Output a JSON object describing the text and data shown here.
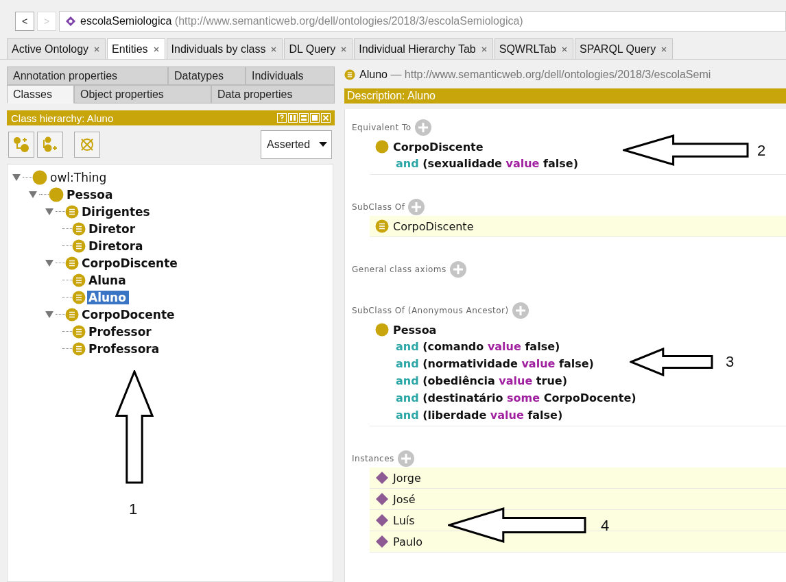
{
  "nav": {
    "back": "<",
    "forward": ">",
    "forward_disabled": true,
    "ontology": {
      "name": "escolaSemiologica",
      "iri": "(http://www.semanticweb.org/dell/ontologies/2018/3/escolaSemiologica)"
    }
  },
  "tabs": [
    {
      "label": "Active Ontology",
      "selected": false
    },
    {
      "label": "Entities",
      "selected": true
    },
    {
      "label": "Individuals by class",
      "selected": false
    },
    {
      "label": "DL Query",
      "selected": false
    },
    {
      "label": "Individual Hierarchy Tab",
      "selected": false
    },
    {
      "label": "SQWRLTab",
      "selected": false
    },
    {
      "label": "SPARQL Query",
      "selected": false
    }
  ],
  "entity_tabs": [
    [
      {
        "label": "Annotation properties",
        "selected": false
      },
      {
        "label": "Datatypes",
        "selected": false
      },
      {
        "label": "Individuals",
        "selected": false
      }
    ],
    [
      {
        "label": "Classes",
        "selected": true
      },
      {
        "label": "Object properties",
        "selected": false
      },
      {
        "label": "Data properties",
        "selected": false
      }
    ]
  ],
  "class_hierarchy": {
    "title": "Class hierarchy: Aluno",
    "mode": "Asserted",
    "tree": [
      {
        "label": "owl:Thing",
        "kind": "primitive",
        "bold": false,
        "selected": false,
        "expanded": true,
        "children": [
          {
            "label": "Pessoa",
            "kind": "primitive",
            "bold": true,
            "selected": false,
            "expanded": true,
            "children": [
              {
                "label": "Dirigentes",
                "kind": "defined",
                "bold": true,
                "selected": false,
                "expanded": true,
                "children": [
                  {
                    "label": "Diretor",
                    "kind": "defined",
                    "bold": true,
                    "selected": false
                  },
                  {
                    "label": "Diretora",
                    "kind": "defined",
                    "bold": true,
                    "selected": false
                  }
                ]
              },
              {
                "label": "CorpoDiscente",
                "kind": "defined",
                "bold": true,
                "selected": false,
                "expanded": true,
                "children": [
                  {
                    "label": "Aluna",
                    "kind": "defined",
                    "bold": true,
                    "selected": false
                  },
                  {
                    "label": "Aluno",
                    "kind": "defined",
                    "bold": true,
                    "selected": true
                  }
                ]
              },
              {
                "label": "CorpoDocente",
                "kind": "defined",
                "bold": true,
                "selected": false,
                "expanded": true,
                "children": [
                  {
                    "label": "Professor",
                    "kind": "defined",
                    "bold": true,
                    "selected": false
                  },
                  {
                    "label": "Professora",
                    "kind": "defined",
                    "bold": true,
                    "selected": false
                  }
                ]
              }
            ]
          }
        ]
      }
    ]
  },
  "entity": {
    "name": "Aluno",
    "iri": "— http://www.semanticweb.org/dell/ontologies/2018/3/escolaSemi"
  },
  "description": {
    "title": "Description: Aluno",
    "sections": [
      {
        "title": "Equivalent To",
        "items": [
          {
            "kind": "expression",
            "highlighted": false,
            "head": "CorpoDiscente",
            "lines": [
              [
                {
                  "text": "and",
                  "kind": "keyword"
                },
                {
                  "text": " (sexualidade ",
                  "kind": "plain"
                },
                {
                  "text": "value",
                  "kind": "restriction"
                },
                {
                  "text": " false)",
                  "kind": "plain"
                }
              ]
            ]
          }
        ]
      },
      {
        "title": "SubClass Of",
        "items": [
          {
            "kind": "class",
            "highlighted": true,
            "head": "CorpoDiscente"
          }
        ]
      },
      {
        "title": "General class axioms"
      },
      {
        "title": "SubClass Of (Anonymous Ancestor)",
        "items": [
          {
            "kind": "expression",
            "highlighted": false,
            "head": "Pessoa",
            "lines": [
              [
                {
                  "text": "and",
                  "kind": "keyword"
                },
                {
                  "text": " (comando ",
                  "kind": "plain"
                },
                {
                  "text": "value",
                  "kind": "restriction"
                },
                {
                  "text": " false)",
                  "kind": "plain"
                }
              ],
              [
                {
                  "text": "and",
                  "kind": "keyword"
                },
                {
                  "text": " (normatividade ",
                  "kind": "plain"
                },
                {
                  "text": "value",
                  "kind": "restriction"
                },
                {
                  "text": " false)",
                  "kind": "plain"
                }
              ],
              [
                {
                  "text": "and",
                  "kind": "keyword"
                },
                {
                  "text": " (obediência ",
                  "kind": "plain"
                },
                {
                  "text": "value",
                  "kind": "restriction"
                },
                {
                  "text": " true)",
                  "kind": "plain"
                }
              ],
              [
                {
                  "text": "and",
                  "kind": "keyword"
                },
                {
                  "text": " (destinatário ",
                  "kind": "plain"
                },
                {
                  "text": "some",
                  "kind": "restriction"
                },
                {
                  "text": " CorpoDocente)",
                  "kind": "plain"
                }
              ],
              [
                {
                  "text": "and",
                  "kind": "keyword"
                },
                {
                  "text": " (liberdade ",
                  "kind": "plain"
                },
                {
                  "text": "value",
                  "kind": "restriction"
                },
                {
                  "text": " false)",
                  "kind": "plain"
                }
              ]
            ]
          }
        ]
      },
      {
        "title": "Instances",
        "items": [
          {
            "kind": "individual",
            "highlighted": true,
            "head": "Jorge"
          },
          {
            "kind": "individual",
            "highlighted": true,
            "head": "José"
          },
          {
            "kind": "individual",
            "highlighted": true,
            "head": "Luís"
          },
          {
            "kind": "individual",
            "highlighted": true,
            "head": "Paulo"
          }
        ]
      }
    ]
  },
  "annotations": [
    {
      "label": "1"
    },
    {
      "label": "2"
    },
    {
      "label": "3"
    },
    {
      "label": "4"
    }
  ]
}
